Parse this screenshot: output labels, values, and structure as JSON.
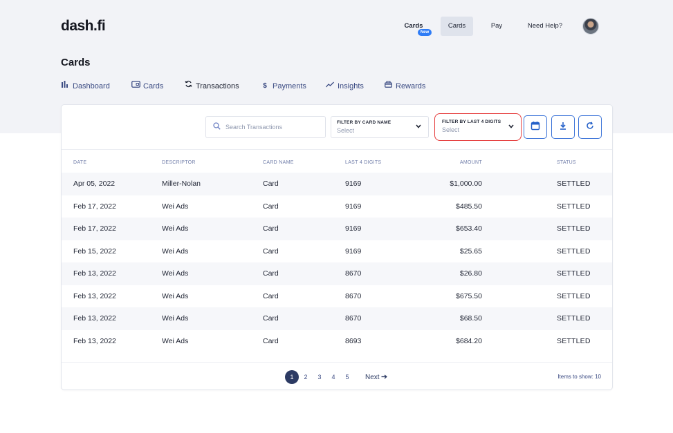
{
  "app": {
    "logo": "dash.fi"
  },
  "topnav": {
    "cards_new_label": "Cards",
    "new_badge": "New",
    "cards_label": "Cards",
    "pay_label": "Pay",
    "help_label": "Need Help?"
  },
  "page": {
    "title": "Cards"
  },
  "subnav": {
    "items": [
      {
        "label": "Dashboard",
        "icon": "bar-chart-icon"
      },
      {
        "label": "Cards",
        "icon": "card-icon"
      },
      {
        "label": "Transactions",
        "icon": "sync-icon"
      },
      {
        "label": "Payments",
        "icon": "dollar-icon"
      },
      {
        "label": "Insights",
        "icon": "trend-line-icon"
      },
      {
        "label": "Rewards",
        "icon": "gift-icon"
      }
    ],
    "active": "Transactions"
  },
  "toolbar": {
    "search_placeholder": "Search Transactions",
    "filter_card_name": {
      "label": "FILTER BY CARD NAME",
      "value": "Select"
    },
    "filter_last4": {
      "label": "FILTER BY LAST 4 DIGITS",
      "value": "Select"
    }
  },
  "table": {
    "headers": [
      "DATE",
      "DESCRIPTOR",
      "CARD NAME",
      "LAST 4 DIGITS",
      "AMOUNT",
      "STATUS"
    ],
    "rows": [
      {
        "date": "Apr 05, 2022",
        "descriptor": "Miller-Nolan",
        "card_name": "Card",
        "last4": "9169",
        "amount": "$1,000.00",
        "status": "SETTLED"
      },
      {
        "date": "Feb 17, 2022",
        "descriptor": "Wei Ads",
        "card_name": "Card",
        "last4": "9169",
        "amount": "$485.50",
        "status": "SETTLED"
      },
      {
        "date": "Feb 17, 2022",
        "descriptor": "Wei Ads",
        "card_name": "Card",
        "last4": "9169",
        "amount": "$653.40",
        "status": "SETTLED"
      },
      {
        "date": "Feb 15, 2022",
        "descriptor": "Wei Ads",
        "card_name": "Card",
        "last4": "9169",
        "amount": "$25.65",
        "status": "SETTLED"
      },
      {
        "date": "Feb 13, 2022",
        "descriptor": "Wei Ads",
        "card_name": "Card",
        "last4": "8670",
        "amount": "$26.80",
        "status": "SETTLED"
      },
      {
        "date": "Feb 13, 2022",
        "descriptor": "Wei Ads",
        "card_name": "Card",
        "last4": "8670",
        "amount": "$675.50",
        "status": "SETTLED"
      },
      {
        "date": "Feb 13, 2022",
        "descriptor": "Wei Ads",
        "card_name": "Card",
        "last4": "8670",
        "amount": "$68.50",
        "status": "SETTLED"
      },
      {
        "date": "Feb 13, 2022",
        "descriptor": "Wei Ads",
        "card_name": "Card",
        "last4": "8693",
        "amount": "$684.20",
        "status": "SETTLED"
      }
    ]
  },
  "pagination": {
    "pages": [
      "1",
      "2",
      "3",
      "4",
      "5"
    ],
    "current": "1",
    "next_label": "Next",
    "items_to_show": "Items to show: 10"
  },
  "colors": {
    "accent": "#2f7cf6",
    "highlight_ring": "#e53a3a",
    "page_active": "#2c3a63"
  }
}
